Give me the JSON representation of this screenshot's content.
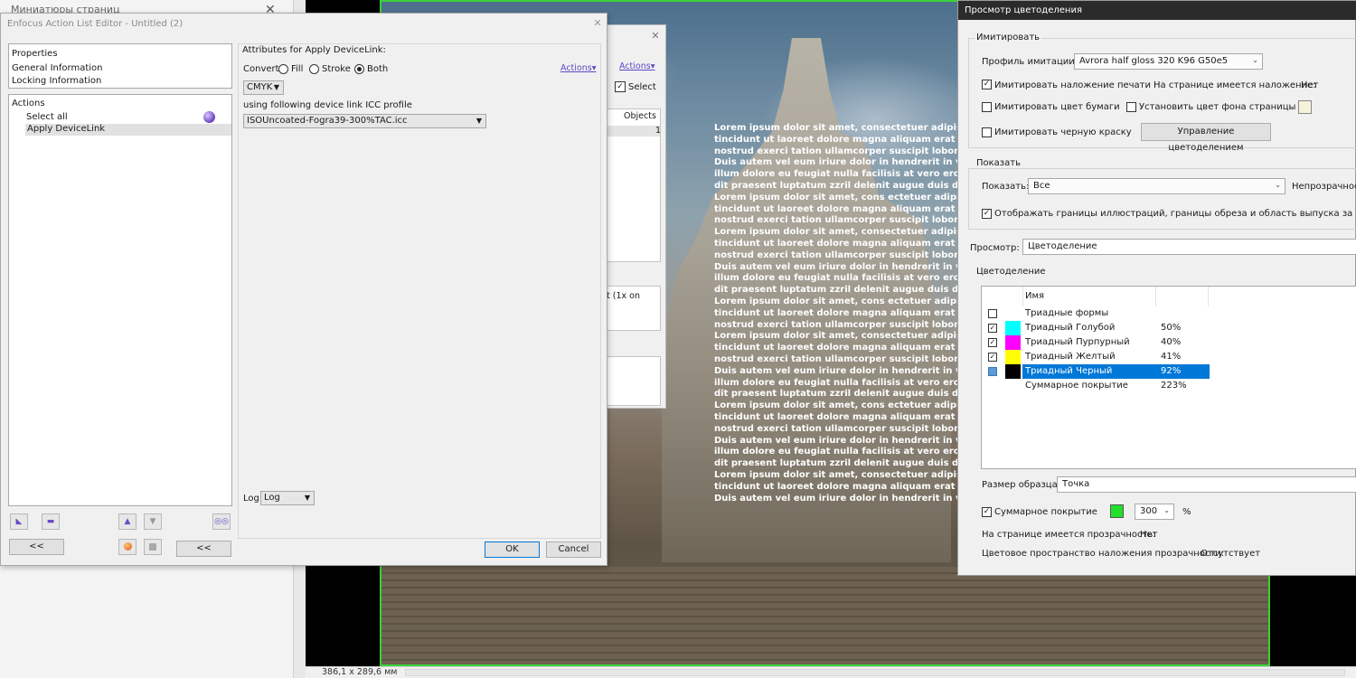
{
  "bg_app": {
    "left_panel_title": "Миниатюры страниц",
    "close_glyph": "✕",
    "status_size": "386,1 x 289,6 мм",
    "lorem_lines": [
      "Lorem ipsum dolor sit amet, consectetuer adipiscing elit,",
      "tincidunt ut laoreet dolore magna aliquam erat volutpat.",
      "nostrud exerci tation ullamcorper suscipit lobortis nisl ut",
      "Duis autem vel eum iriure dolor in hendrerit in vulputate",
      "illum dolore eu feugiat nulla facilisis at vero eros et accu",
      "dit praesent luptatum zzril delenit augue duis dolore te f",
      "Lorem ipsum dolor sit amet, cons ectetuer adipiscing elit,",
      "tincidunt ut laoreet dolore magna aliquam erat volutpat.",
      "nostrud exerci tation ullamcorper suscipit lobortis nisl ut",
      "Lorem ipsum dolor sit amet, consectetuer adipiscing elit,",
      "tincidunt ut laoreet dolore magna aliquam erat volutpat.",
      "nostrud exerci tation ullamcorper suscipit lobortis nisl ut",
      "Duis autem vel eum iriure dolor in hendrerit in vulputate",
      "illum dolore eu feugiat nulla facilisis at vero eros et accu",
      "dit praesent luptatum zzril delenit augue duis dolore te f",
      "Lorem ipsum dolor sit amet, cons ectetuer adipiscing elit,",
      "tincidunt ut laoreet dolore magna aliquam erat volutpat.",
      "nostrud exerci tation ullamcorper suscipit lobortis nisl ut",
      "Lorem ipsum dolor sit amet, consectetuer adipiscing elit,",
      "tincidunt ut laoreet dolore magna aliquam erat volutpat.",
      "nostrud exerci tation ullamcorper suscipit lobortis nisl ut",
      "Duis autem vel eum iriure dolor in hendrerit in vulputate",
      "illum dolore eu feugiat nulla facilisis at vero eros et accu",
      "dit praesent luptatum zzril delenit augue duis dolore te f",
      "Lorem ipsum dolor sit amet, cons ectetuer adipiscing elit,",
      "tincidunt ut laoreet dolore magna aliquam erat volutpat.",
      "nostrud exerci tation ullamcorper suscipit lobortis nisl ut",
      "Duis autem vel eum iriure dolor in hendrerit in vulputate",
      "illum dolore eu feugiat nulla facilisis at vero eros et accu",
      "dit praesent luptatum zzril delenit augue duis dolore te f",
      "Lorem ipsum dolor sit amet, consectetuer adipiscing elit,",
      "tincidunt ut laoreet dolore magna aliquam erat volutpat.",
      "Duis autem vel eum iriure dolor in hendrerit in vulputate",
      "illum dolore eu feugiat nulla facilisis at vero eros et accu"
    ]
  },
  "bg_window": {
    "close_glyph": "✕",
    "actions_link": "Actions▾",
    "select_label": "Select",
    "select_check": "✓",
    "objects_header": "Objects",
    "objects_value": "1",
    "note_text": "t (1x on"
  },
  "enfocus": {
    "title": "Enfocus Action List Editor - Untitled (2)",
    "close_glyph": "✕",
    "properties": {
      "header": "Properties",
      "items": [
        "General Information",
        "Locking Information"
      ]
    },
    "actions": {
      "header": "Actions",
      "items": [
        "Select all",
        "Apply DeviceLink"
      ]
    },
    "toolbar": {
      "collapse_label": "<<",
      "collapse_label_2": "<<",
      "minus_glyph": "▬",
      "up_glyph": "▲",
      "down_glyph": "▼"
    },
    "attributes": {
      "title": "Attributes for Apply DeviceLink:",
      "convert_label": "Convert",
      "fill_label": "Fill",
      "stroke_label": "Stroke",
      "both_label": "Both",
      "selected_option": "Both",
      "actions_link": "Actions▾",
      "color_space": "CMYK",
      "profile_label": "using following device link ICC profile",
      "profile_value": "ISOUncoated-Fogra39-300%TAC.icc",
      "log_label": "Log",
      "log_value": "Log"
    },
    "ok_label": "OK",
    "cancel_label": "Cancel"
  },
  "separation": {
    "title": "Просмотр цветоделения",
    "simulate_group": "Имитировать",
    "profile_label": "Профиль имитации:",
    "profile_value": "Avrora half gloss 320 K96 G50e5",
    "sim_overprint_label": "Имитировать наложение печати",
    "sim_overprint_checked": true,
    "page_overprint_label": "На странице имеется наложение:",
    "page_overprint_value": "Нет",
    "sim_paper_label": "Имитировать цвет бумаги",
    "set_bg_label": "Установить цвет фона страницы",
    "sim_black_label": "Имитировать черную краску",
    "manage_button": "Управление цветоделением",
    "show_group": "Показать",
    "show_label": "Показать:",
    "show_value": "Все",
    "opacity_label": "Непрозрачность",
    "show_borders_label": "Отображать границы иллюстраций, границы обреза и область выпуска за обрез",
    "preview_label": "Просмотр:",
    "preview_value": "Цветоделение",
    "separation_group": "Цветоделение",
    "table": {
      "name_header": "Имя",
      "rows": [
        {
          "name": "Триадные формы",
          "percent": "",
          "checked": false,
          "swatch": "",
          "selected": false
        },
        {
          "name": "Триадный Голубой",
          "percent": "50%",
          "checked": true,
          "swatch": "#00ffff",
          "selected": false
        },
        {
          "name": "Триадный Пурпурный",
          "percent": "40%",
          "checked": true,
          "swatch": "#ff00ff",
          "selected": false
        },
        {
          "name": "Триадный Желтый",
          "percent": "41%",
          "checked": true,
          "swatch": "#ffff00",
          "selected": false
        },
        {
          "name": "Триадный Черный",
          "percent": "92%",
          "checked": true,
          "swatch": "#000000",
          "selected": true
        },
        {
          "name": "Суммарное покрытие",
          "percent": "223%",
          "checked": false,
          "swatch": "",
          "selected": false
        }
      ]
    },
    "sample_size_label": "Размер образца:",
    "sample_size_value": "Точка",
    "total_coverage_label": "Суммарное покрытие",
    "total_coverage_color": "#22e02a",
    "total_coverage_value": "300",
    "percent_sign": "%",
    "page_transparency_label": "На странице имеется прозрачность:",
    "page_transparency_value": "Нет",
    "blend_space_label": "Цветовое пространство наложения прозрачности:",
    "blend_space_value": "Отсутствует",
    "check_glyph": "✓",
    "arrow_glyph": "⌄"
  }
}
